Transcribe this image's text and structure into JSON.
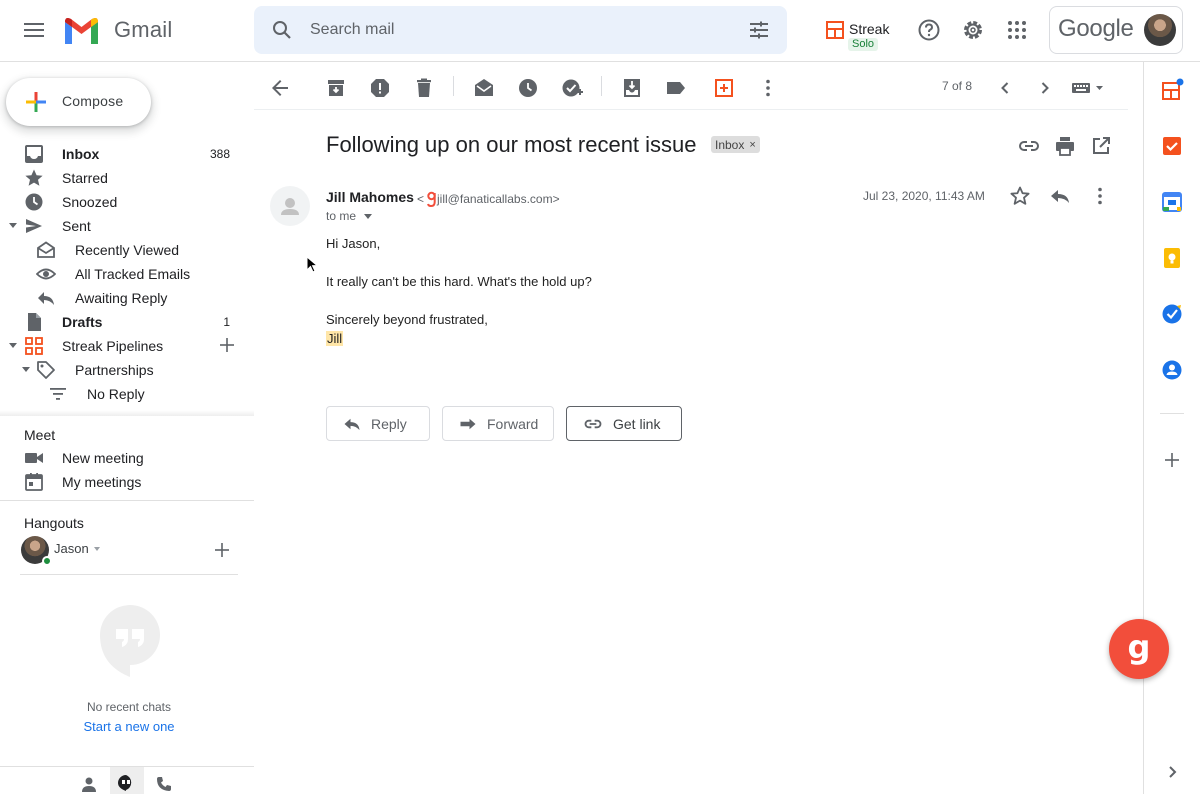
{
  "header": {
    "app_name": "Gmail",
    "search_placeholder": "Search mail",
    "streak": {
      "name": "Streak",
      "plan": "Solo"
    },
    "account_brand": "Google"
  },
  "sidebar": {
    "compose_label": "Compose",
    "items": [
      {
        "label": "Inbox",
        "count": "388",
        "bold": true
      },
      {
        "label": "Starred"
      },
      {
        "label": "Snoozed"
      },
      {
        "label": "Sent"
      },
      {
        "label": "Recently Viewed"
      },
      {
        "label": "All Tracked Emails"
      },
      {
        "label": "Awaiting Reply"
      },
      {
        "label": "Drafts",
        "count": "1",
        "bold": true
      },
      {
        "label": "Streak Pipelines"
      },
      {
        "label": "Partnerships"
      },
      {
        "label": "No Reply"
      }
    ],
    "meet": {
      "title": "Meet",
      "new_meeting": "New meeting",
      "my_meetings": "My meetings"
    },
    "hangouts": {
      "title": "Hangouts",
      "user": "Jason",
      "no_chats": "No recent chats",
      "start_new": "Start a new one"
    }
  },
  "toolbar": {
    "pager": "7 of 8"
  },
  "email": {
    "subject": "Following up on our most recent issue",
    "label_chip": "Inbox",
    "chip_close": "×",
    "sender_name": "Jill Mahomes",
    "sender_email": "jill@fanaticallabs.com",
    "email_prefix": "<",
    "email_suffix": ">",
    "recipient": "to me",
    "date": "Jul 23, 2020, 11:43 AM",
    "body": {
      "greeting": "Hi Jason,",
      "line1": "It really can't be this hard. What's the hold up?",
      "closing": "Sincerely beyond frustrated,",
      "signature": "Jill"
    },
    "actions": {
      "reply": "Reply",
      "forward": "Forward",
      "get_link": "Get link"
    }
  },
  "fab_glyph": "g",
  "colors": {
    "accent_red": "#f24e3b",
    "gmail_red": "#ea4335",
    "streak_orange": "#f4511e",
    "link_blue": "#1a73e8",
    "online_green": "#1e8e3e"
  }
}
